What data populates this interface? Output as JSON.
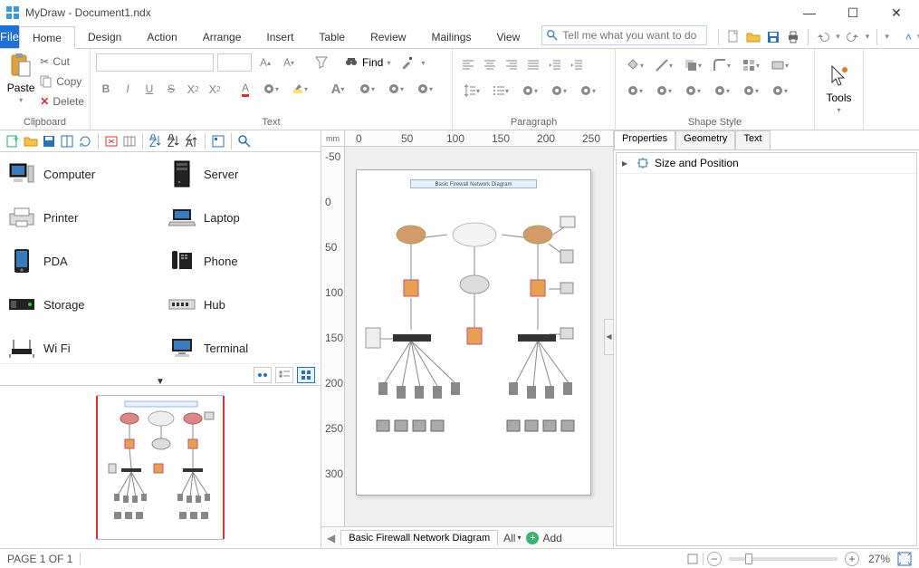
{
  "app": {
    "title": "MyDraw - Document1.ndx"
  },
  "tabs": {
    "file": "File",
    "list": [
      "Home",
      "Design",
      "Action",
      "Arrange",
      "Insert",
      "Table",
      "Review",
      "Mailings",
      "View"
    ],
    "active": "Home"
  },
  "tellme": {
    "placeholder": "Tell me what you want to do"
  },
  "ribbon": {
    "clipboard": {
      "label": "Clipboard",
      "paste": "Paste",
      "cut": "Cut",
      "copy": "Copy",
      "delete": "Delete"
    },
    "text": {
      "label": "Text",
      "find": "Find"
    },
    "paragraph": {
      "label": "Paragraph"
    },
    "shapestyle": {
      "label": "Shape Style"
    },
    "tools": {
      "label": "Tools"
    }
  },
  "ruler": {
    "unit": "mm",
    "h": [
      "0",
      "50",
      "100",
      "150",
      "200",
      "250"
    ],
    "v": [
      "-50",
      "0",
      "50",
      "100",
      "150",
      "200",
      "250",
      "300"
    ]
  },
  "library": {
    "items": [
      {
        "label": "Computer"
      },
      {
        "label": "Server"
      },
      {
        "label": "Printer"
      },
      {
        "label": "Laptop"
      },
      {
        "label": "PDA"
      },
      {
        "label": "Phone"
      },
      {
        "label": "Storage"
      },
      {
        "label": "Hub"
      },
      {
        "label": "Wi Fi"
      },
      {
        "label": "Terminal"
      }
    ]
  },
  "canvas": {
    "diagram_title": "Basic Firewall Network Diagram"
  },
  "sheets": {
    "tab": "Basic Firewall Network Diagram",
    "all": "All",
    "add": "Add"
  },
  "props": {
    "tabs": [
      "Properties",
      "Geometry",
      "Text"
    ],
    "active": "Properties",
    "row0": "Size and Position"
  },
  "status": {
    "page": "PAGE 1 OF 1",
    "zoom": "27%"
  }
}
